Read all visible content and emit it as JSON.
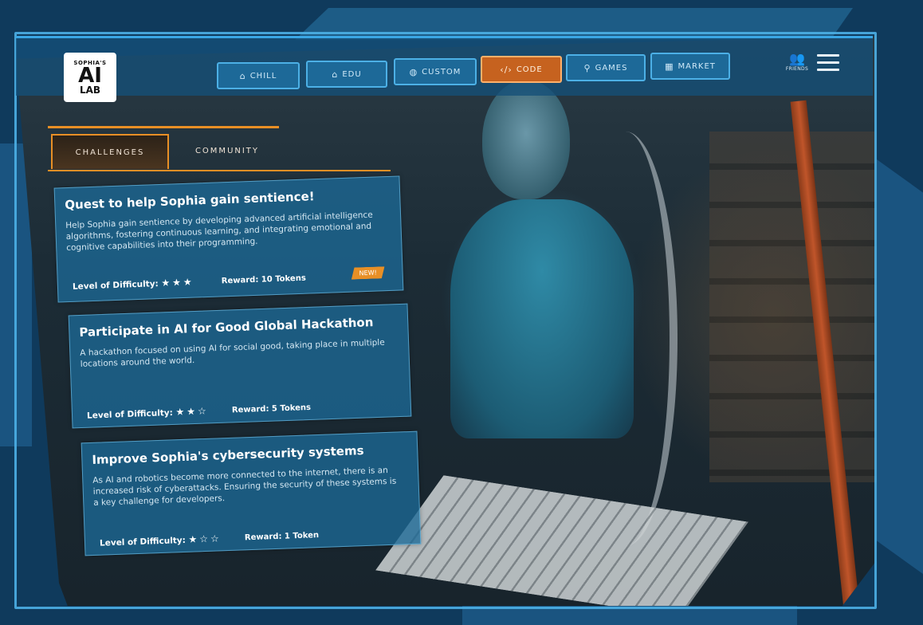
{
  "logo": {
    "line1": "SOPHIA'S",
    "line2": "AI",
    "line3": "LAB"
  },
  "nav": [
    {
      "label": "CHILL",
      "icon": "⌂",
      "icon_name": "home-icon"
    },
    {
      "label": "EDU",
      "icon": "⌂",
      "icon_name": "school-icon"
    },
    {
      "label": "CUSTOM",
      "icon": "◍",
      "icon_name": "custom-icon"
    },
    {
      "label": "CODE",
      "icon": "‹/›",
      "icon_name": "code-icon",
      "active": true
    },
    {
      "label": "GAMES",
      "icon": "⚲",
      "icon_name": "gamepad-icon"
    },
    {
      "label": "MARKET",
      "icon": "▦",
      "icon_name": "store-icon"
    }
  ],
  "friends": {
    "label": "FRIENDS",
    "icon": "👥"
  },
  "tabs": {
    "challenges": "CHALLENGES",
    "community": "COMMUNITY"
  },
  "challenges": [
    {
      "title": "Quest to help Sophia gain sentience!",
      "description": "Help Sophia gain sentience by developing advanced artificial intelligence algorithms, fostering continuous learning, and integrating emotional and cognitive capabilities into their programming.",
      "difficulty_label": "Level of Difficulty:",
      "stars": "★★★",
      "reward": "Reward: 10 Tokens",
      "badge": "NEW!"
    },
    {
      "title": "Participate in AI for Good Global Hackathon",
      "description": "A hackathon focused on using AI for social good, taking place in multiple locations around the world.",
      "difficulty_label": "Level of Difficulty:",
      "stars": "★★☆",
      "reward": "Reward: 5 Tokens"
    },
    {
      "title": "Improve Sophia's cybersecurity systems",
      "description": "As AI and robotics become more connected to the internet, there is an increased risk of cyberattacks. Ensuring the security of these systems is a key challenge for developers.",
      "difficulty_label": "Level of Difficulty:",
      "stars": "★☆☆",
      "reward": "Reward: 1 Token"
    }
  ],
  "colors": {
    "accent_orange": "#e88f25",
    "frame_blue": "#4cb0e6",
    "bg_navy": "#0f3a5c"
  }
}
